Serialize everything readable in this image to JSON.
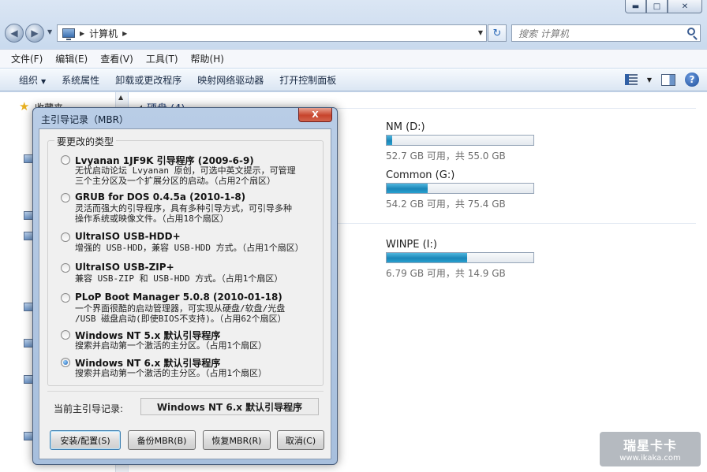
{
  "window": {
    "minimize_glyph": "▬",
    "maximize_glyph": "□",
    "close_glyph": "✕"
  },
  "address_bar": {
    "location": "计算机",
    "search_placeholder": "搜索 计算机"
  },
  "menu": [
    "文件(F)",
    "编辑(E)",
    "查看(V)",
    "工具(T)",
    "帮助(H)"
  ],
  "toolbar": {
    "organize": "组织",
    "items": [
      "系统属性",
      "卸载或更改程序",
      "映射网络驱动器",
      "打开控制面板"
    ],
    "help_glyph": "?"
  },
  "nav_pane": {
    "favorites": "收藏夹"
  },
  "content": {
    "group_title": "硬盘 (4)",
    "drives": [
      {
        "name": "NM (D:)",
        "info": "52.7 GB 可用，共 55.0 GB",
        "used_fraction": 0.04
      },
      {
        "name": "Common (G:)",
        "info": "54.2 GB 可用，共 75.4 GB",
        "used_fraction": 0.28
      },
      {
        "name": "WINPE (I:)",
        "info": "6.79 GB 可用，共 14.9 GB",
        "used_fraction": 0.55
      }
    ]
  },
  "dialog": {
    "title": "主引导记录（MBR）",
    "close_glyph": "X",
    "group_title": "要更改的类型",
    "options": [
      {
        "label": "Lvyanan 1JF9K 引导程序 (2009-6-9)",
        "desc": "无忧启动论坛 Lvyanan 原创，可选中英文提示，可管理\n三个主分区及一个扩展分区的启动。（占用2个扇区）",
        "selected": false
      },
      {
        "label": "GRUB for DOS 0.4.5a (2010-1-8)",
        "desc": "灵活而强大的引导程序，具有多种引导方式，可引导多种\n操作系统或映像文件。（占用18个扇区）",
        "selected": false
      },
      {
        "label": "UltraISO USB-HDD+",
        "desc": "增强的 USB-HDD，兼容 USB-HDD 方式。（占用1个扇区）",
        "selected": false
      },
      {
        "label": "UltraISO USB-ZIP+",
        "desc": "兼容 USB-ZIP 和 USB-HDD 方式。（占用1个扇区）",
        "selected": false
      },
      {
        "label": "PLoP Boot Manager 5.0.8 (2010-01-18)",
        "desc": "一个界面很酷的启动管理器，可实现从硬盘/软盘/光盘\n/USB 磁盘启动(即使BIOS不支持)。（占用62个扇区）",
        "selected": false
      },
      {
        "label": "Windows NT 5.x 默认引导程序",
        "desc": "搜索并启动第一个激活的主分区。（占用1个扇区）",
        "selected": false
      },
      {
        "label": "Windows NT 6.x 默认引导程序",
        "desc": "搜索并启动第一个激活的主分区。（占用1个扇区）",
        "selected": true
      }
    ],
    "current_label": "当前主引导记录:",
    "current_value": "Windows NT 6.x 默认引导程序",
    "buttons": {
      "install": "安装/配置(S)",
      "backup": "备份MBR(B)",
      "restore": "恢复MBR(R)",
      "cancel": "取消(C)"
    }
  },
  "watermark": {
    "brand": "瑞星卡卡",
    "url": "www.ikaka.com"
  }
}
